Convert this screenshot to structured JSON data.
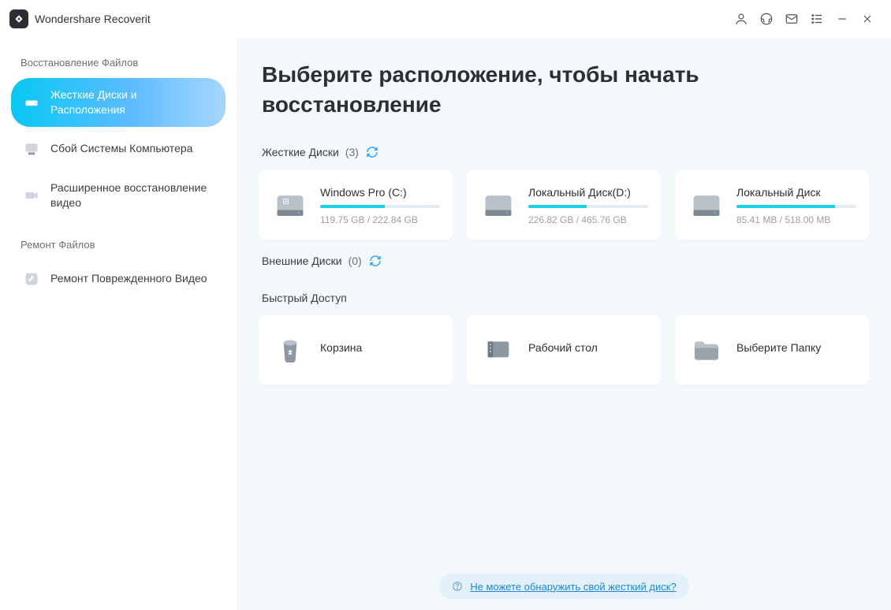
{
  "app": {
    "title": "Wondershare Recoverit"
  },
  "sidebar": {
    "section1_title": "Восстановление Файлов",
    "section2_title": "Ремонт Файлов",
    "items": [
      {
        "label": "Жесткие Диски и Расположения",
        "active": true
      },
      {
        "label": "Сбой Системы Компьютера",
        "active": false
      },
      {
        "label": "Расширенное восстановление видео",
        "active": false
      }
    ],
    "repair_items": [
      {
        "label": "Ремонт Поврежденного Видео"
      }
    ]
  },
  "main": {
    "heading": "Выберите расположение, чтобы начать восстановление",
    "hard_disks": {
      "title": "Жесткие Диски",
      "count": "(3)",
      "items": [
        {
          "name": "Windows Pro (C:)",
          "used": "119.75 GB",
          "total": "222.84 GB",
          "pct": 54
        },
        {
          "name": "Локальный Диск(D:)",
          "used": "226.82 GB",
          "total": "465.76 GB",
          "pct": 49
        },
        {
          "name": "Локальный Диск",
          "used": "85.41 MB",
          "total": "518.00 MB",
          "pct": 82
        }
      ]
    },
    "external_disks": {
      "title": "Внешние Диски",
      "count": "(0)"
    },
    "quick_access": {
      "title": "Быстрый Доступ",
      "items": [
        {
          "name": "Корзина"
        },
        {
          "name": "Рабочий стол"
        },
        {
          "name": "Выберите Папку"
        }
      ]
    },
    "tip": {
      "text": "Не можете обнаружить свой жесткий диск?"
    }
  }
}
